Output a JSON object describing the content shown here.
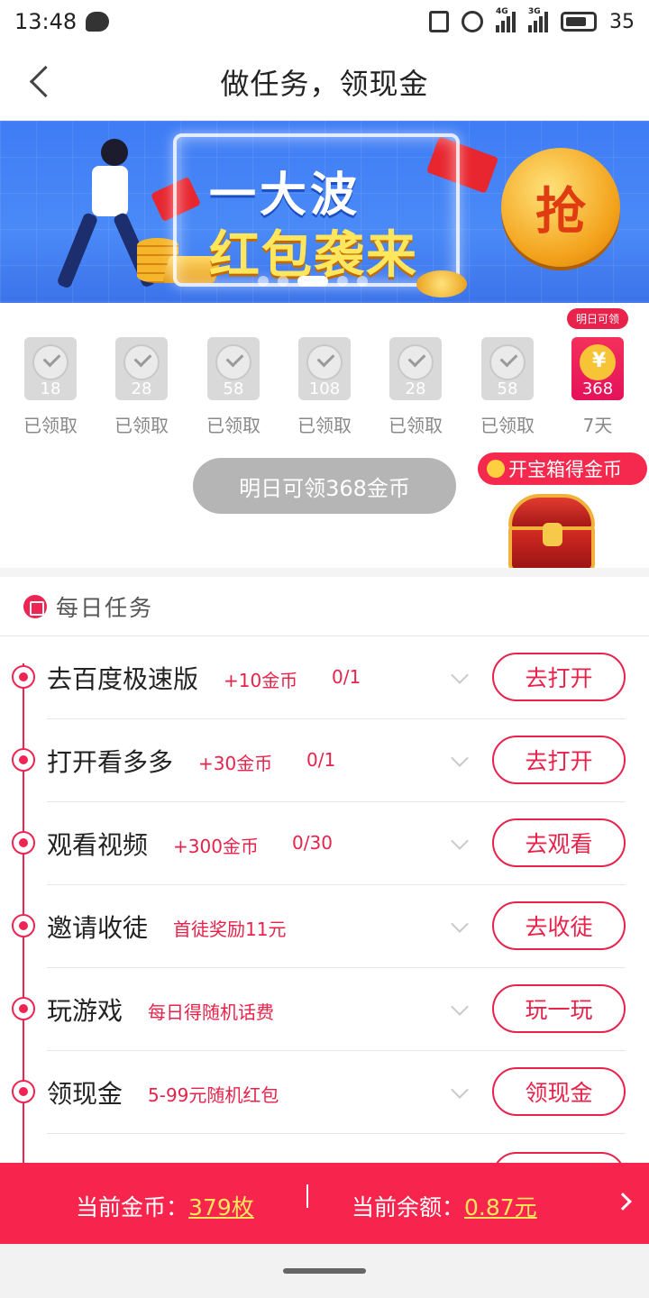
{
  "status_bar": {
    "time": "13:48",
    "battery": "35",
    "net1": "4G",
    "net2": "3G"
  },
  "header": {
    "title": "做任务，领现金"
  },
  "banner": {
    "line1": "一大波",
    "line2": "红包袭来",
    "coin_label": "抢"
  },
  "checkin": {
    "days": [
      {
        "amount": "18",
        "label": "已领取"
      },
      {
        "amount": "28",
        "label": "已领取"
      },
      {
        "amount": "58",
        "label": "已领取"
      },
      {
        "amount": "108",
        "label": "已领取"
      },
      {
        "amount": "28",
        "label": "已领取"
      },
      {
        "amount": "58",
        "label": "已领取"
      },
      {
        "amount": "368",
        "label": "7天",
        "tag": "明日可领"
      }
    ],
    "claim_button": "明日可领368金币",
    "chest_badge": "开宝箱得金币"
  },
  "section": {
    "title": "每日任务"
  },
  "tasks": [
    {
      "name": "去百度极速版",
      "reward": "+10金币",
      "progress": "0/1",
      "button": "去打开"
    },
    {
      "name": "打开看多多",
      "reward": "+30金币",
      "progress": "0/1",
      "button": "去打开"
    },
    {
      "name": "观看视频",
      "reward": "+300金币",
      "progress": "0/30",
      "button": "去观看"
    },
    {
      "name": "邀请收徒",
      "reward": "首徒奖励11元",
      "progress": "",
      "button": "去收徒"
    },
    {
      "name": "玩游戏",
      "reward": "每日得随机话费",
      "progress": "",
      "button": "玩一玩"
    },
    {
      "name": "领现金",
      "reward": "5-99元随机红包",
      "progress": "",
      "button": "领现金"
    }
  ],
  "bottom_bar": {
    "coins_label": "当前金币：",
    "coins_value": "379枚",
    "balance_label": "当前余额：",
    "balance_value": "0.87元"
  },
  "colors": {
    "accent": "#e8224a",
    "bottom_bar": "#f7254d",
    "banner_blue": "#4a8af7"
  }
}
